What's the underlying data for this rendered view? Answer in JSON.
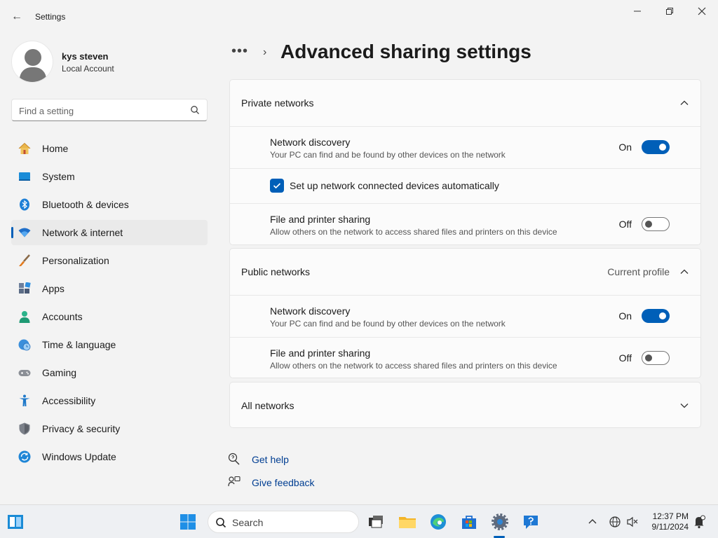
{
  "window": {
    "title": "Settings",
    "back": "←",
    "minimize": "—",
    "maximize": "❐",
    "close": "✕"
  },
  "profile": {
    "name": "kys steven",
    "subtitle": "Local Account"
  },
  "search": {
    "placeholder": "Find a setting"
  },
  "nav": [
    {
      "label": "Home",
      "icon": "home-icon"
    },
    {
      "label": "System",
      "icon": "system-icon"
    },
    {
      "label": "Bluetooth & devices",
      "icon": "bluetooth-icon"
    },
    {
      "label": "Network & internet",
      "icon": "wifi-icon",
      "active": true
    },
    {
      "label": "Personalization",
      "icon": "paintbrush-icon"
    },
    {
      "label": "Apps",
      "icon": "apps-icon"
    },
    {
      "label": "Accounts",
      "icon": "accounts-icon"
    },
    {
      "label": "Time & language",
      "icon": "time-language-icon"
    },
    {
      "label": "Gaming",
      "icon": "gamepad-icon"
    },
    {
      "label": "Accessibility",
      "icon": "accessibility-icon"
    },
    {
      "label": "Privacy & security",
      "icon": "shield-icon"
    },
    {
      "label": "Windows Update",
      "icon": "windows-update-icon"
    }
  ],
  "breadcrumb": {
    "dots": "•••",
    "separator": "›",
    "title": "Advanced sharing settings"
  },
  "private": {
    "title": "Private networks",
    "discovery": {
      "title": "Network discovery",
      "desc": "Your PC can find and be found by other devices on the network",
      "state": "On"
    },
    "auto_setup": {
      "label": "Set up network connected devices automatically",
      "checked": true
    },
    "sharing": {
      "title": "File and printer sharing",
      "desc": "Allow others on the network to access shared files and printers on this device",
      "state": "Off"
    }
  },
  "public": {
    "title": "Public networks",
    "profile": "Current profile",
    "discovery": {
      "title": "Network discovery",
      "desc": "Your PC can find and be found by other devices on the network",
      "state": "On"
    },
    "sharing": {
      "title": "File and printer sharing",
      "desc": "Allow others on the network to access shared files and printers on this device",
      "state": "Off"
    }
  },
  "all": {
    "title": "All networks"
  },
  "help": {
    "get_help": "Get help",
    "feedback": "Give feedback"
  },
  "taskbar": {
    "search_label": "Search",
    "time": "12:37 PM",
    "date": "9/11/2024"
  },
  "colors": {
    "accent": "#005fb8",
    "link": "#003e92"
  }
}
